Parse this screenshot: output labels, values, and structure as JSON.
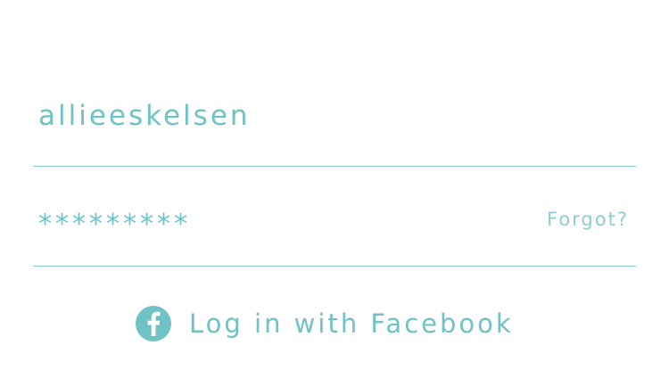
{
  "login_form": {
    "username_value": "allieeskelsen",
    "password_value": "*********",
    "forgot_label": "Forgot?",
    "facebook_label": "Log in with Facebook",
    "facebook_icon": "facebook-icon"
  },
  "colors": {
    "accent": "#6fc2c6",
    "divider": "#8fc9cd",
    "background": "#ffffff"
  }
}
